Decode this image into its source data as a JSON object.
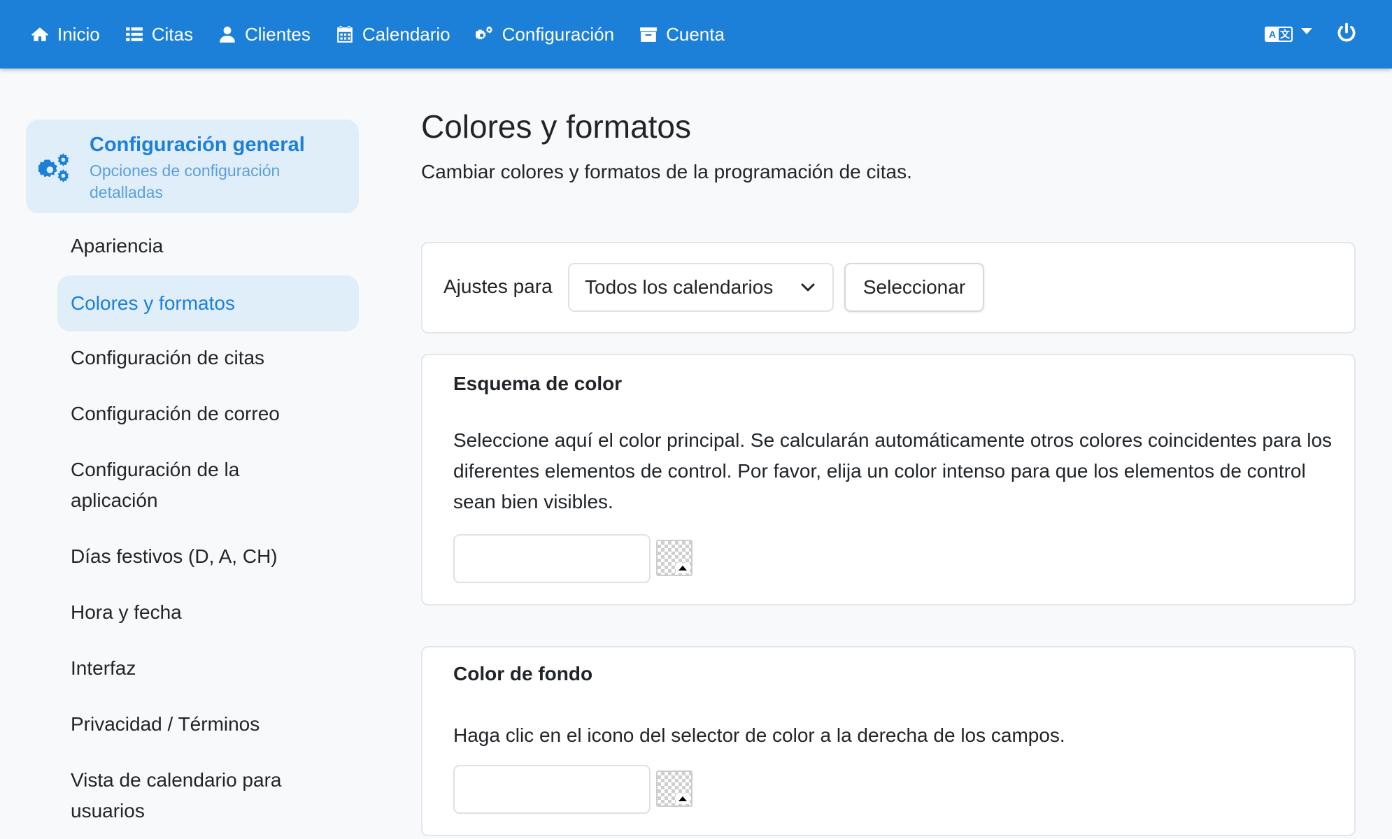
{
  "nav": {
    "items": [
      {
        "label": "Inicio",
        "icon": "home-icon"
      },
      {
        "label": "Citas",
        "icon": "list-icon"
      },
      {
        "label": "Clientes",
        "icon": "user-icon"
      },
      {
        "label": "Calendario",
        "icon": "calendar-icon"
      },
      {
        "label": "Configuración",
        "icon": "gears-icon"
      },
      {
        "label": "Cuenta",
        "icon": "archive-icon"
      }
    ],
    "language_icon": "language-icon",
    "power_icon": "power-icon"
  },
  "sidebar": {
    "header_title": "Configuración general",
    "header_subtitle": "Opciones de configuración detalladas",
    "items": [
      {
        "label": "Apariencia"
      },
      {
        "label": "Colores y formatos",
        "active": true
      },
      {
        "label": "Configuración de citas"
      },
      {
        "label": "Configuración de correo"
      },
      {
        "label": "Configuración de la aplicación"
      },
      {
        "label": "Días festivos (D, A, CH)"
      },
      {
        "label": "Hora y fecha"
      },
      {
        "label": "Interfaz"
      },
      {
        "label": "Privacidad / Términos"
      },
      {
        "label": "Vista de calendario para usuarios"
      }
    ]
  },
  "main": {
    "title": "Colores y formatos",
    "description": "Cambiar colores y formatos de la programación de citas.",
    "settings": {
      "label": "Ajustes para",
      "selected": "Todos los calendarios",
      "button": "Seleccionar"
    },
    "color_scheme": {
      "heading": "Esquema de color",
      "text": "Seleccione aquí el color principal. Se calcularán automáticamente otros colores coincidentes para los diferentes elementos de control. Por favor, elija un color intenso para que los elementos de control sean bien visibles.",
      "value": ""
    },
    "background_color": {
      "heading": "Color de fondo",
      "text": "Haga clic en el icono del selector de color a la derecha de los campos.",
      "value": ""
    }
  },
  "colors": {
    "primary": "#1c80d9",
    "sidebar_active_bg": "#e0eef9",
    "page_bg": "#f8f9fa"
  }
}
